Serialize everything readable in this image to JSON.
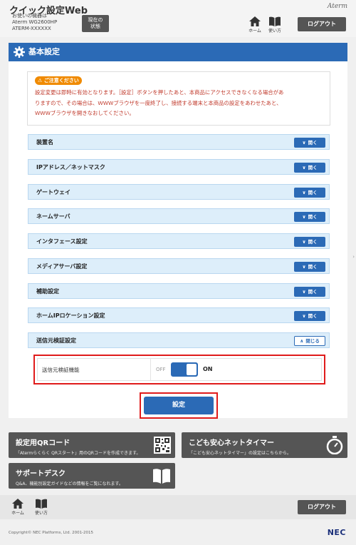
{
  "header": {
    "app_title": "クイック設定Web",
    "device_caption": "お使いの機器は",
    "device_model": "Aterm WG2600HP",
    "device_name": "ATERM-XXXXXX",
    "status_button_line1": "現在の",
    "status_button_line2": "状態",
    "brand": "Aterm",
    "home_label": "ホーム",
    "help_label": "使い方",
    "logout_label": "ログアウト"
  },
  "main": {
    "title": "基本設定",
    "notice_badge": "ご注意ください",
    "notice_line1": "設定変更は即時に有効となります。［設定］ボタンを押したあと、本商品にアクセスできなくなる場合があ",
    "notice_line2": "りますので、その場合は、WWWブラウザを一度終了し、接続する端末と本商品の設定をあわせたあと、",
    "notice_line3": "WWWブラウザを開きなおしてください。",
    "open_label": "開く",
    "close_label": "閉じる",
    "sections": [
      {
        "label": "装置名"
      },
      {
        "label": "IPアドレス／ネットマスク"
      },
      {
        "label": "ゲートウェイ"
      },
      {
        "label": "ネームサーバ"
      },
      {
        "label": "インタフェース設定"
      },
      {
        "label": "メディアサーバ設定"
      },
      {
        "label": "補助設定"
      },
      {
        "label": "ホームIPロケーション設定"
      },
      {
        "label": "送信元検証設定"
      }
    ],
    "setting": {
      "label": "送信元検証機能",
      "off_label": "OFF",
      "on_label": "ON",
      "state": "ON"
    },
    "submit_label": "設定"
  },
  "tiles": {
    "qr_title": "設定用QRコード",
    "qr_desc": "「Atermらくらく QRスタート」用のQRコードを作成できます。",
    "timer_title": "こども安心ネットタイマー",
    "timer_desc": "「こども安心ネットタイマー」の設定はこちらから。",
    "support_title": "サポートデスク",
    "support_desc": "Q&A、機能別設定ガイドなどの情報をご覧になれます。"
  },
  "footer": {
    "home_label": "ホーム",
    "help_label": "使い方",
    "logout_label": "ログアウト",
    "copyright": "Copyright© NEC Platforms, Ltd. 2001-2015",
    "logo": "NEC"
  },
  "colors": {
    "accent": "#2b6ab6",
    "highlight": "#e01b1b",
    "notice": "#c0392b",
    "badge": "#f08a00"
  }
}
